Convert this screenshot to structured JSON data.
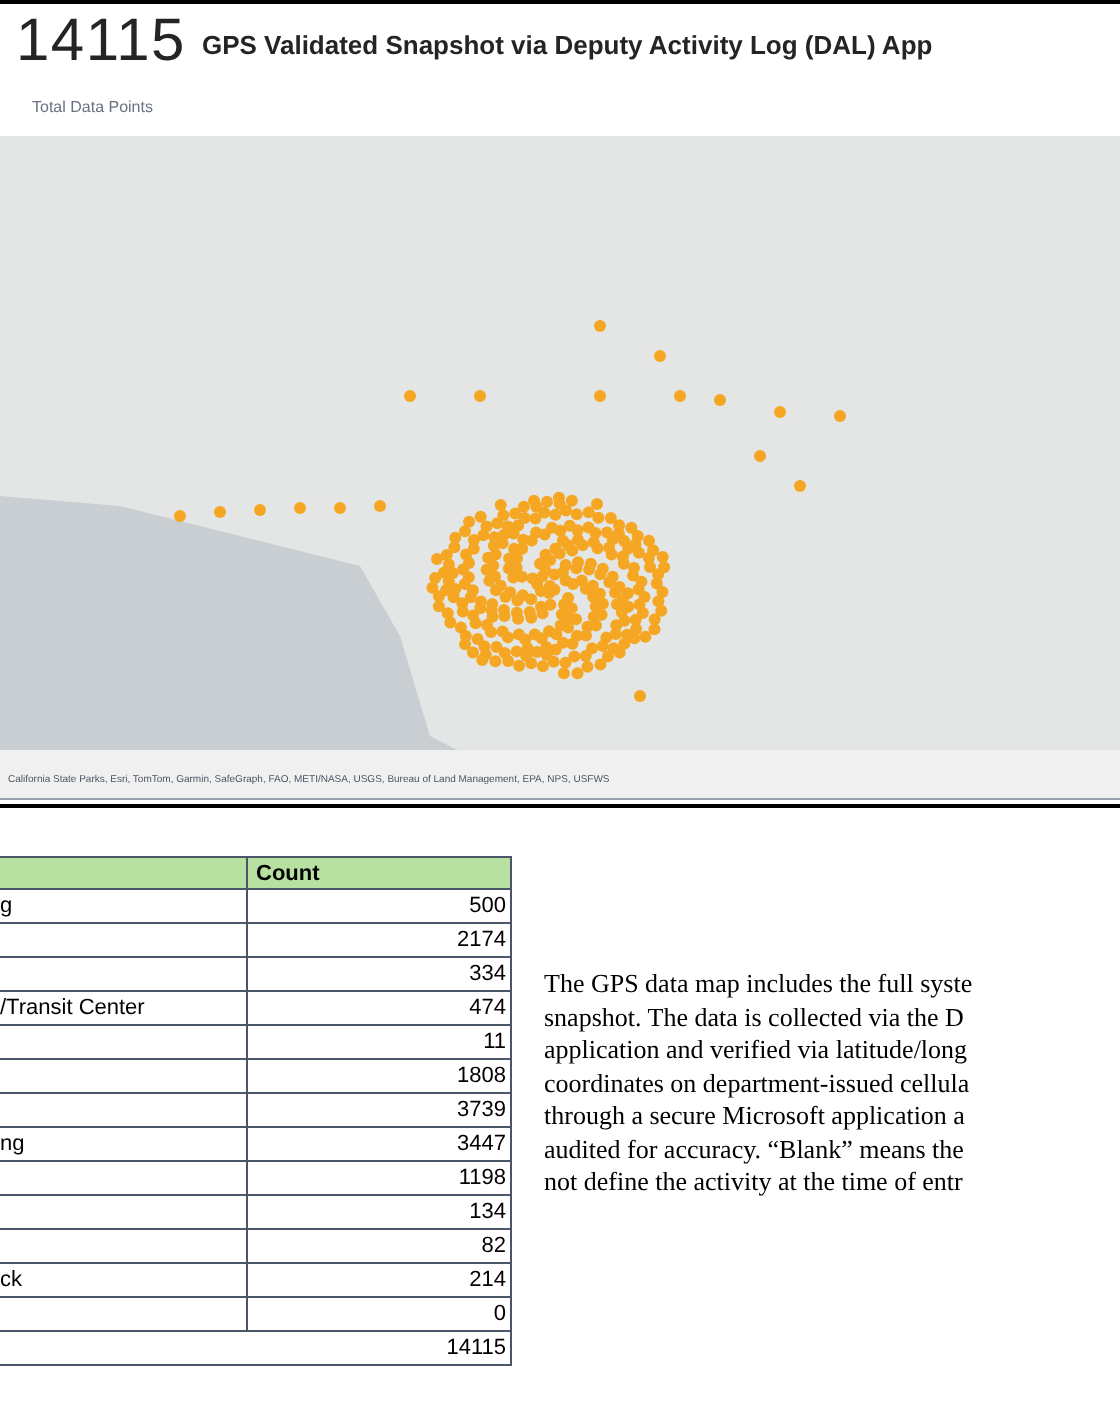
{
  "header": {
    "total": "14115",
    "title": "GPS Validated Snapshot via Deputy Activity Log (DAL) App",
    "total_label": "Total Data Points"
  },
  "map": {
    "attribution": "California State Parks, Esri, TomTom, Garmin, SafeGraph, FAO, METI/NASA, USGS, Bureau of Land Management, EPA, NPS, USFWS"
  },
  "table": {
    "columns": [
      "Count"
    ],
    "rows": [
      {
        "column_1": "g",
        "count": "500"
      },
      {
        "count": "2174"
      },
      {
        "count": "334"
      },
      {
        "column_1": "/Transit Center",
        "count": "474"
      },
      {
        "count": "11"
      },
      {
        "count": "1808"
      },
      {
        "count": "3739"
      },
      {
        "column_1": "ng",
        "count": "3447"
      },
      {
        "count": "1198"
      },
      {
        "count": "134"
      },
      {
        "count": "82"
      },
      {
        "column_1": "ck",
        "count": "214"
      },
      {
        "count": "0"
      }
    ],
    "total": "14115"
  },
  "description": [
    "The GPS data map includes the full syste",
    "snapshot. The data is collected via the D",
    "application and verified via latitude/long",
    "coordinates on department-issued cellula",
    "through a secure Microsoft application a",
    "audited for accuracy. “Blank” means the",
    "not define the activity at the time of entr"
  ]
}
